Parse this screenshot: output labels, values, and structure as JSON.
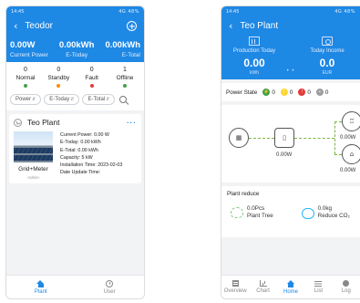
{
  "left": {
    "status": {
      "time": "14:45",
      "right": "4G 48%"
    },
    "header": {
      "title": "Teodor"
    },
    "totals": [
      {
        "value": "0.00W",
        "label": "Current Power"
      },
      {
        "value": "0.00kWh",
        "label": "E-Today"
      },
      {
        "value": "0.00kWh",
        "label": "E-Total"
      }
    ],
    "counts": [
      {
        "count": "0",
        "label": "Normal",
        "color": "#43a047"
      },
      {
        "count": "0",
        "label": "Standby",
        "color": "#fb8c00"
      },
      {
        "count": "0",
        "label": "Fault",
        "color": "#e53935"
      },
      {
        "count": "1",
        "label": "Offline",
        "color": "#43a047"
      }
    ],
    "filters": [
      "Power",
      "E-Today",
      "E-Total"
    ],
    "plant": {
      "name": "Teo Plant",
      "type": "Grid+Meter",
      "owner": "Admin",
      "info": [
        "Current Power: 0.00 W",
        "E-Today: 0.00 kWh",
        "E-Total: 0.00 kWh",
        "Capacity: 5 kW",
        "Installation Time: 2023-02-03",
        "Date Update Time:"
      ]
    },
    "tabs": [
      {
        "label": "Plant",
        "icon": "home-icon"
      },
      {
        "label": "User",
        "icon": "user-icon"
      }
    ]
  },
  "right": {
    "status": {
      "time": "14:45",
      "right": "4G 48%"
    },
    "header": {
      "title": "Teo Plant"
    },
    "production": {
      "label": "Production Today",
      "value": "0.00",
      "unit": "kWh"
    },
    "income": {
      "label": "Today Income",
      "value": "0.0",
      "unit": "EUR"
    },
    "power_state": {
      "label": "Power State",
      "items": [
        {
          "count": "0",
          "symbol": "⚡",
          "color": "#43a047"
        },
        {
          "count": "0",
          "symbol": "!",
          "color": "#fdd835"
        },
        {
          "count": "0",
          "symbol": "!",
          "color": "#e53935"
        },
        {
          "count": "0",
          "symbol": "•",
          "color": "#9e9e9e"
        }
      ]
    },
    "flow": {
      "inverter": "0.00W",
      "grid": "0.00W",
      "home": "0.00W"
    },
    "reduce": {
      "title": "Plant reduce",
      "tree_value": "0.0Pcs",
      "tree_label": "Plant Tree",
      "co2_value": "0.0kg",
      "co2_label": "Reduce CO₂"
    },
    "tabs": [
      {
        "label": "Overview"
      },
      {
        "label": "Chart"
      },
      {
        "label": "Home"
      },
      {
        "label": "List"
      },
      {
        "label": "Log"
      }
    ]
  }
}
